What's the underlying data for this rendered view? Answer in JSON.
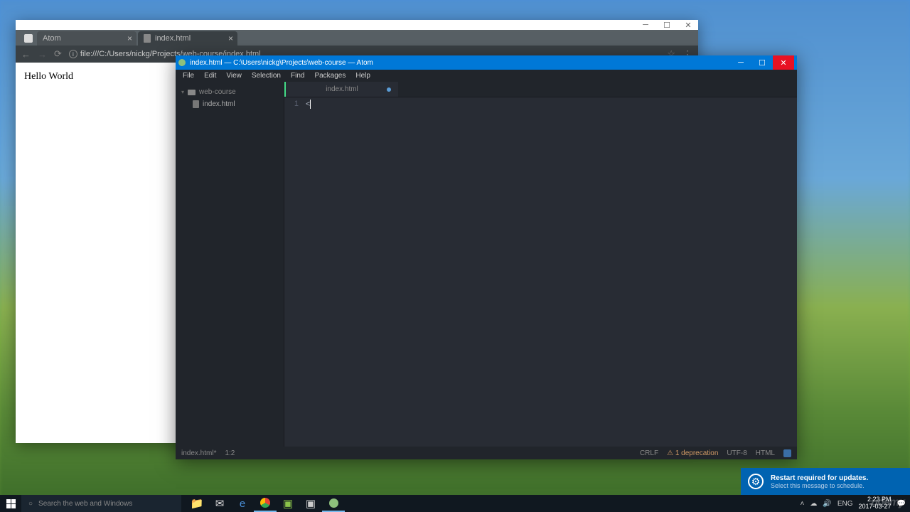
{
  "chrome": {
    "tabs": [
      {
        "title": "Atom"
      },
      {
        "title": "index.html"
      }
    ],
    "url": "file:///C:/Users/nickg/Projects/web-course/index.html",
    "page_content": "Hello World"
  },
  "atom": {
    "title": "index.html — C:\\Users\\nickg\\Projects\\web-course — Atom",
    "menu": [
      "File",
      "Edit",
      "View",
      "Selection",
      "Find",
      "Packages",
      "Help"
    ],
    "tree": {
      "folder": "web-course",
      "files": [
        "index.html"
      ]
    },
    "editor": {
      "tab": "index.html",
      "line_number": "1",
      "content": "<"
    },
    "status": {
      "file": "index.html*",
      "position": "1:2",
      "line_ending": "CRLF",
      "warning": "1 deprecation",
      "encoding": "UTF-8",
      "grammar": "HTML"
    }
  },
  "notification": {
    "title": "Restart required for updates.",
    "subtitle": "Select this message to schedule."
  },
  "taskbar": {
    "search_placeholder": "Search the web and Windows",
    "lang": "ENG",
    "time": "2:23 PM",
    "date": "2017-03-27"
  },
  "watermark": "udemy"
}
